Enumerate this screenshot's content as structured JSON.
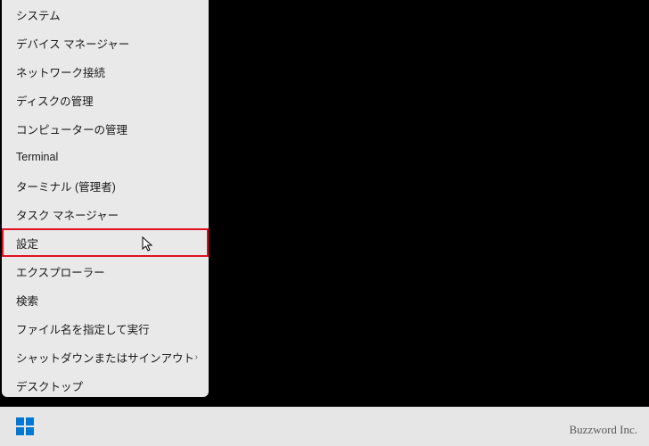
{
  "menu": {
    "items": [
      {
        "label": "システム",
        "highlighted": false,
        "submenu": false
      },
      {
        "label": "デバイス マネージャー",
        "highlighted": false,
        "submenu": false
      },
      {
        "label": "ネットワーク接続",
        "highlighted": false,
        "submenu": false
      },
      {
        "label": "ディスクの管理",
        "highlighted": false,
        "submenu": false
      },
      {
        "label": "コンピューターの管理",
        "highlighted": false,
        "submenu": false
      },
      {
        "label": "Terminal",
        "highlighted": false,
        "submenu": false
      },
      {
        "label": "ターミナル (管理者)",
        "highlighted": false,
        "submenu": false
      },
      {
        "label": "タスク マネージャー",
        "highlighted": false,
        "submenu": false
      },
      {
        "label": "設定",
        "highlighted": true,
        "submenu": false
      },
      {
        "label": "エクスプローラー",
        "highlighted": false,
        "submenu": false
      },
      {
        "label": "検索",
        "highlighted": false,
        "submenu": false
      },
      {
        "label": "ファイル名を指定して実行",
        "highlighted": false,
        "submenu": false
      },
      {
        "label": "シャットダウンまたはサインアウト",
        "highlighted": false,
        "submenu": true
      },
      {
        "label": "デスクトップ",
        "highlighted": false,
        "submenu": false
      }
    ],
    "submenu_glyph": "›"
  },
  "watermark": "Buzzword Inc."
}
